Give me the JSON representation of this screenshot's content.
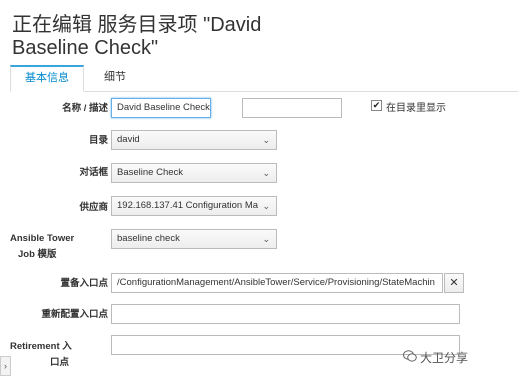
{
  "page": {
    "title": "正在编辑 服务目录项 \"David Baseline Check\""
  },
  "tabs": [
    {
      "label": "基本信息"
    },
    {
      "label": "细节"
    }
  ],
  "form": {
    "name_label": "名称 / 描述",
    "name_value": "David Baseline Check",
    "description_value": "",
    "display_in_catalog_label": "在目录里显示",
    "display_in_catalog_checked": true,
    "catalog_label": "目录",
    "catalog_value": "david",
    "dialog_label": "对话框",
    "dialog_value": "Baseline Check",
    "provider_label": "供应商",
    "provider_value": "192.168.137.41 Configuration Ma",
    "job_template_label_1": "Ansible Tower",
    "job_template_label_2": "Job 模版",
    "job_template_value": "baseline check",
    "provisioning_entry_label": "置备入口点",
    "provisioning_entry_value": "/ConfigurationManagement/AnsibleTower/Service/Provisioning/StateMachin",
    "clear_button": "✕",
    "reconfigure_entry_label": "重新配置入口点",
    "reconfigure_entry_value": "",
    "retirement_entry_label_1": "Retirement 入",
    "retirement_entry_label_2": "口点",
    "retirement_entry_value": ""
  },
  "icons": {
    "caret": "caret-down-icon",
    "collapse": "chevron-right-icon",
    "watermark": "wechat-icon"
  },
  "watermark": {
    "text": "大卫分享"
  },
  "colors": {
    "accent": "#39a5dc",
    "active_tab_text": "#0088ce"
  }
}
